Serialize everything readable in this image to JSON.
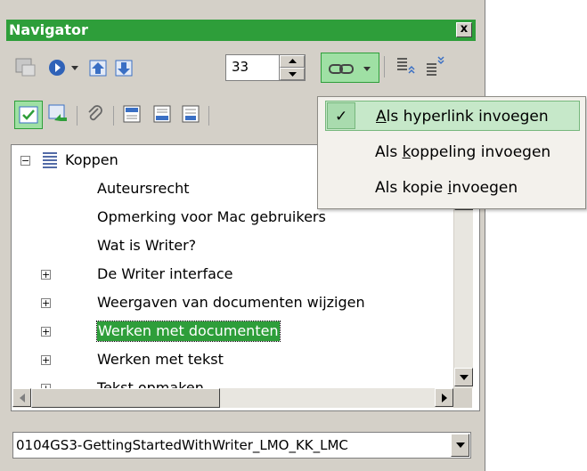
{
  "window": {
    "title": "Navigator",
    "close_label": "x"
  },
  "toolbar": {
    "page_number": "33",
    "icons": [
      "toggle-icon",
      "navigation-icon",
      "dropdown-arrow-icon",
      "previous-icon",
      "next-icon",
      "drag-mode-icon",
      "dropdown-arrow-icon",
      "headings-up-icon",
      "headings-down-icon",
      "content-view-icon",
      "set-reminder-icon",
      "paperclip-icon",
      "header-icon",
      "footer-icon",
      "anchor-icon"
    ]
  },
  "drag_menu": {
    "items": [
      {
        "label_pre": "",
        "label_ul": "A",
        "label_post": "ls hyperlink invoegen",
        "checked": true
      },
      {
        "label_pre": "Als ",
        "label_ul": "k",
        "label_post": "oppeling invoegen",
        "checked": false
      },
      {
        "label_pre": "Als kopie ",
        "label_ul": "i",
        "label_post": "nvoegen",
        "checked": false
      }
    ]
  },
  "tree": {
    "root": {
      "label": "Koppen",
      "expander": "−"
    },
    "items": [
      {
        "label": "Auteursrecht",
        "expander": ""
      },
      {
        "label": "Opmerking voor Mac gebruikers",
        "expander": ""
      },
      {
        "label": "Wat is Writer?",
        "expander": ""
      },
      {
        "label": "De Writer interface",
        "expander": "+"
      },
      {
        "label": "Weergaven van documenten wijzigen",
        "expander": "+"
      },
      {
        "label": "Werken met documenten",
        "expander": "+",
        "selected": true
      },
      {
        "label": "Werken met tekst",
        "expander": "+"
      },
      {
        "label": "Tekst opmaken",
        "expander": "+"
      }
    ]
  },
  "document_select": {
    "value": "0104GS3-GettingStartedWithWriter_LMO_KK_LMC"
  },
  "colors": {
    "accent": "#2e9e3a",
    "menu_highlight": "#c6e8c9"
  }
}
